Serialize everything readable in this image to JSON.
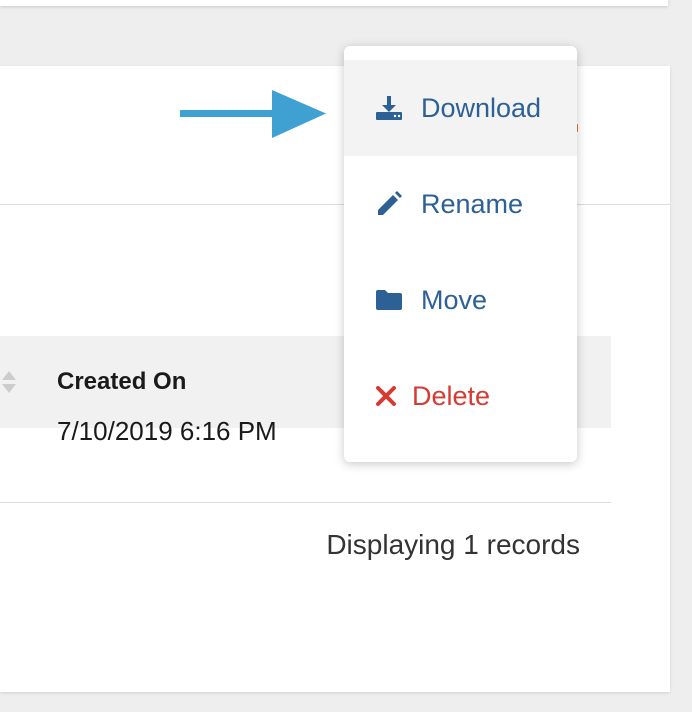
{
  "table": {
    "column_header": "Created On",
    "rows": [
      {
        "created_on": "7/10/2019 6:16 PM"
      }
    ],
    "footer": "Displaying 1 records"
  },
  "context_menu": {
    "items": [
      {
        "label": "Download",
        "icon": "download-icon",
        "highlighted": true
      },
      {
        "label": "Rename",
        "icon": "pencil-icon"
      },
      {
        "label": "Move",
        "icon": "folder-icon"
      },
      {
        "label": "Delete",
        "icon": "close-icon",
        "danger": true
      }
    ]
  },
  "colors": {
    "menu_text": "#2d6196",
    "danger": "#d63b33",
    "arrow": "#3fa0d2",
    "header_bg": "#f1f1f1"
  }
}
